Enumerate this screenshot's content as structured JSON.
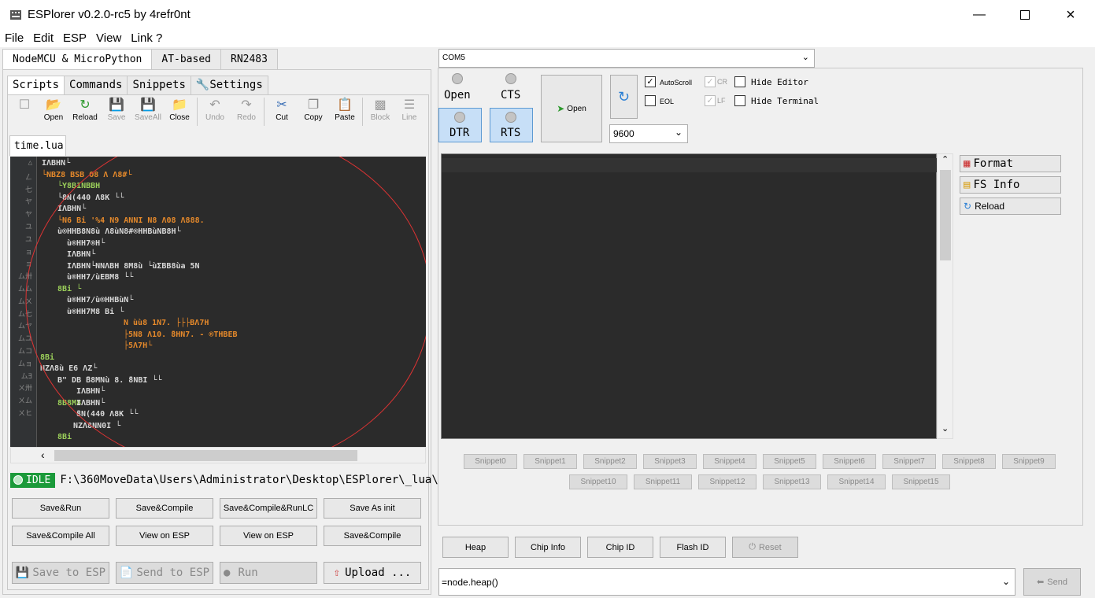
{
  "window": {
    "title": "ESPlorer v0.2.0-rc5 by 4refr0nt"
  },
  "menu": [
    "File",
    "Edit",
    "ESP",
    "View",
    "Link ?"
  ],
  "left": {
    "outer_tabs": [
      "NodeMCU & MicroPython",
      "AT-based",
      "RN2483"
    ],
    "inner_tabs": [
      "Scripts",
      "Commands",
      "Snippets",
      "Settings"
    ],
    "toolbar": [
      "Open",
      "Reload",
      "Save",
      "SaveAll",
      "Close",
      "Undo",
      "Redo",
      "Cut",
      "Copy",
      "Paste",
      "Block",
      "Line"
    ],
    "file_tab": "time.lua",
    "line_numbers": [
      "△",
      "ㄥ",
      "七",
      "ヤ",
      "ヤ",
      "ユ",
      "ユ",
      "ョ",
      "ョ",
      "ム卅",
      "ムム",
      "ムㄨ",
      "ム七",
      "ムヤ",
      "ムユ",
      "ムコ",
      "ムョ",
      "ム∃",
      "ㄨ卅",
      "ㄨム",
      "ㄨヒ"
    ],
    "code_lines": [
      {
        "c": "w",
        "t": "IΛBHN└"
      },
      {
        "c": "o",
        "t": "└NBZ8 BSB  O8 Λ  Λ8#└"
      },
      {
        "c": "g",
        "t": "└Y8B1NBBH"
      },
      {
        "c": "w",
        "t": "└8N(440 Λ8K └└"
      },
      {
        "c": "w",
        "t": "IΛBHN└"
      },
      {
        "c": "o",
        "t": "└N6 Bi  '%4   N9   ANNI   N8 Λ08 Λ888."
      },
      {
        "c": "w",
        "t": "ù®HHB8N8ù Λ8ùN8#®HHBùNB8H└"
      },
      {
        "c": "w",
        "t": "ù®HH7®H└"
      },
      {
        "c": "w",
        "t": "IΛBHN└"
      },
      {
        "c": "w",
        "t": "IΛBHN└NNΛBH 8M8ù └ùΣBB8ùa 5N"
      },
      {
        "c": "w",
        "t": "ù®HH7/ùEBM8 └└"
      },
      {
        "c": "g",
        "t": "8Bi └"
      },
      {
        "c": "w",
        "t": "ù®HH7/ù®HHBùN└"
      },
      {
        "c": "w",
        "t": "ù®HH7M8 Bi └"
      },
      {
        "c": "o",
        "t": "N ùù8 1N7.  ├├├BΛ7H"
      },
      {
        "c": "o",
        "t": "├5N8 Λ10.  ̄8HN7. - ®THBEB"
      },
      {
        "c": "o",
        "t": "├5Λ7H└"
      },
      {
        "c": "g",
        "t": "8Bi"
      },
      {
        "c": "w",
        "t": "NZΛ8ù E6 ΛZ└"
      },
      {
        "c": "w",
        "t": "B\" DB ̄B8MNù 8. ̄8NBI └└"
      },
      {
        "c": "w",
        "t": "IΛBHN└"
      },
      {
        "c": "g",
        "t": "8B8M8"
      },
      {
        "c": "w",
        "t": "IΛBHN└"
      },
      {
        "c": "w",
        "t": " ̄8N(440 Λ8K └└"
      },
      {
        "c": "w",
        "t": "NZΛ8NN0I └"
      },
      {
        "c": "g",
        "t": "8Bi"
      }
    ],
    "status": {
      "state": "IDLE",
      "path": "F:\\360MoveData\\Users\\Administrator\\Desktop\\ESPlorer\\_lua\\"
    },
    "buttons_row1": [
      "Save&Run",
      "Save&Compile",
      "Save&Compile&RunLC",
      "Save As init"
    ],
    "buttons_row2": [
      "Save&Compile All",
      "View on ESP",
      "View on ESP",
      "Save&Compile"
    ],
    "buttons_row3": [
      "Save to ESP",
      "Send to ESP",
      "Run",
      "Upload ..."
    ]
  },
  "right": {
    "port": "COM5",
    "open_led": "Open",
    "cts_led": "CTS",
    "dtr": "DTR",
    "rts": "RTS",
    "open_button": "Open",
    "baud": "9600",
    "checks": [
      {
        "label": "AutoScroll",
        "checked": true,
        "disabled": false
      },
      {
        "label": "EOL",
        "checked": false,
        "disabled": false
      },
      {
        "label": "CR",
        "checked": true,
        "disabled": true
      },
      {
        "label": "LF",
        "checked": true,
        "disabled": true
      },
      {
        "label": "Hide Editor",
        "checked": false,
        "disabled": false
      },
      {
        "label": "Hide Terminal",
        "checked": false,
        "disabled": false
      }
    ],
    "side_buttons": [
      "Format",
      "FS Info",
      "Reload"
    ],
    "snippets_row1": [
      "Snippet0",
      "Snippet1",
      "Snippet2",
      "Snippet3",
      "Snippet4",
      "Snippet5",
      "Snippet6",
      "Snippet7",
      "Snippet8",
      "Snippet9"
    ],
    "snippets_row2": [
      "Snippet10",
      "Snippet11",
      "Snippet12",
      "Snippet13",
      "Snippet14",
      "Snippet15"
    ],
    "bottom_buttons": [
      "Heap",
      "Chip Info",
      "Chip ID",
      "Flash ID",
      "Reset"
    ],
    "command": "=node.heap()",
    "send": "Send"
  }
}
